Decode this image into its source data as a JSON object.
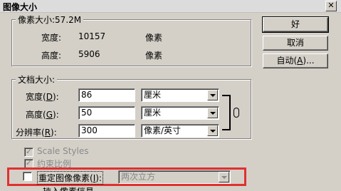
{
  "window": {
    "title": "图像大小",
    "close_glyph": "✕"
  },
  "pixel_dimensions": {
    "legend": "像素大小:57.2M",
    "width_label": "宽度:",
    "width_value": "10157",
    "width_unit": "像素",
    "height_label": "高度:",
    "height_value": "5906",
    "height_unit": "像素"
  },
  "document_size": {
    "legend": "文档大小:",
    "width_label": "宽度",
    "width_key": "D",
    "width_value": "86",
    "width_unit": "厘米",
    "height_label": "高度",
    "height_key": "G",
    "height_value": "50",
    "height_unit": "厘米",
    "resolution_label": "分辨率",
    "resolution_key": "R",
    "resolution_value": "300",
    "resolution_unit": "像素/英寸"
  },
  "options": {
    "scale_styles": {
      "label": "Scale Styles",
      "checked": true,
      "enabled": false
    },
    "constrain": {
      "label": "约束比例",
      "checked": true,
      "enabled": false
    },
    "resample": {
      "label": "重定图像像素",
      "key": "I",
      "checked": false,
      "method": "两次立方"
    },
    "cut_off_text": "插入像素信息"
  },
  "buttons": {
    "ok": "好",
    "cancel": "取消",
    "auto": "自动",
    "auto_key": "A",
    "ellipsis": "..."
  },
  "colors": {
    "highlight": "#e03030",
    "dialog_bg": "#d4d0c8"
  }
}
